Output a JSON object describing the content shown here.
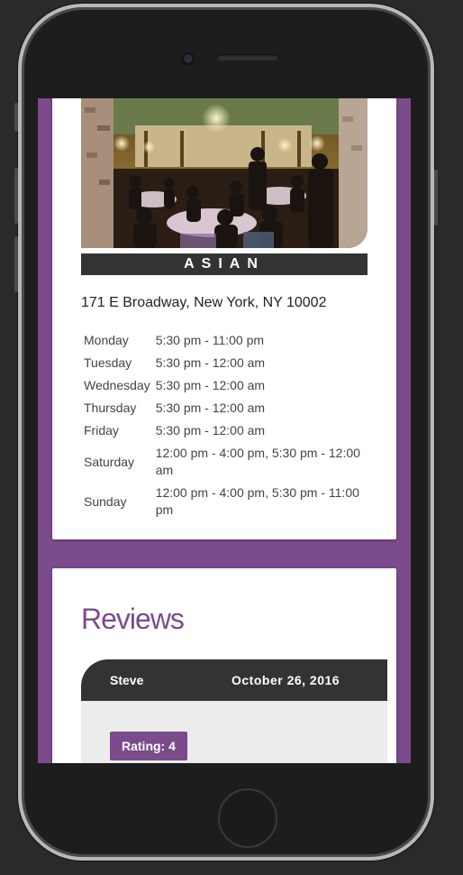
{
  "restaurant": {
    "cuisine": "ASIAN",
    "address": "171 E Broadway, New York, NY 10002",
    "hours": [
      {
        "day": "Monday",
        "time": "5:30 pm - 11:00 pm"
      },
      {
        "day": "Tuesday",
        "time": "5:30 pm - 12:00 am"
      },
      {
        "day": "Wednesday",
        "time": "5:30 pm - 12:00 am"
      },
      {
        "day": "Thursday",
        "time": "5:30 pm - 12:00 am"
      },
      {
        "day": "Friday",
        "time": "5:30 pm - 12:00 am"
      },
      {
        "day": "Saturday",
        "time": "12:00 pm - 4:00 pm, 5:30 pm - 12:00 am"
      },
      {
        "day": "Sunday",
        "time": "12:00 pm - 4:00 pm, 5:30 pm - 11:00 pm"
      }
    ]
  },
  "reviews": {
    "title": "Reviews",
    "items": [
      {
        "name": "Steve",
        "date": "October 26, 2016",
        "rating": "Rating: 4"
      }
    ]
  },
  "colors": {
    "brand": "#7b4b8c",
    "dark": "#333333",
    "review_bg": "#ececec"
  },
  "icons": {
    "photo": "restaurant-interior-photo"
  }
}
